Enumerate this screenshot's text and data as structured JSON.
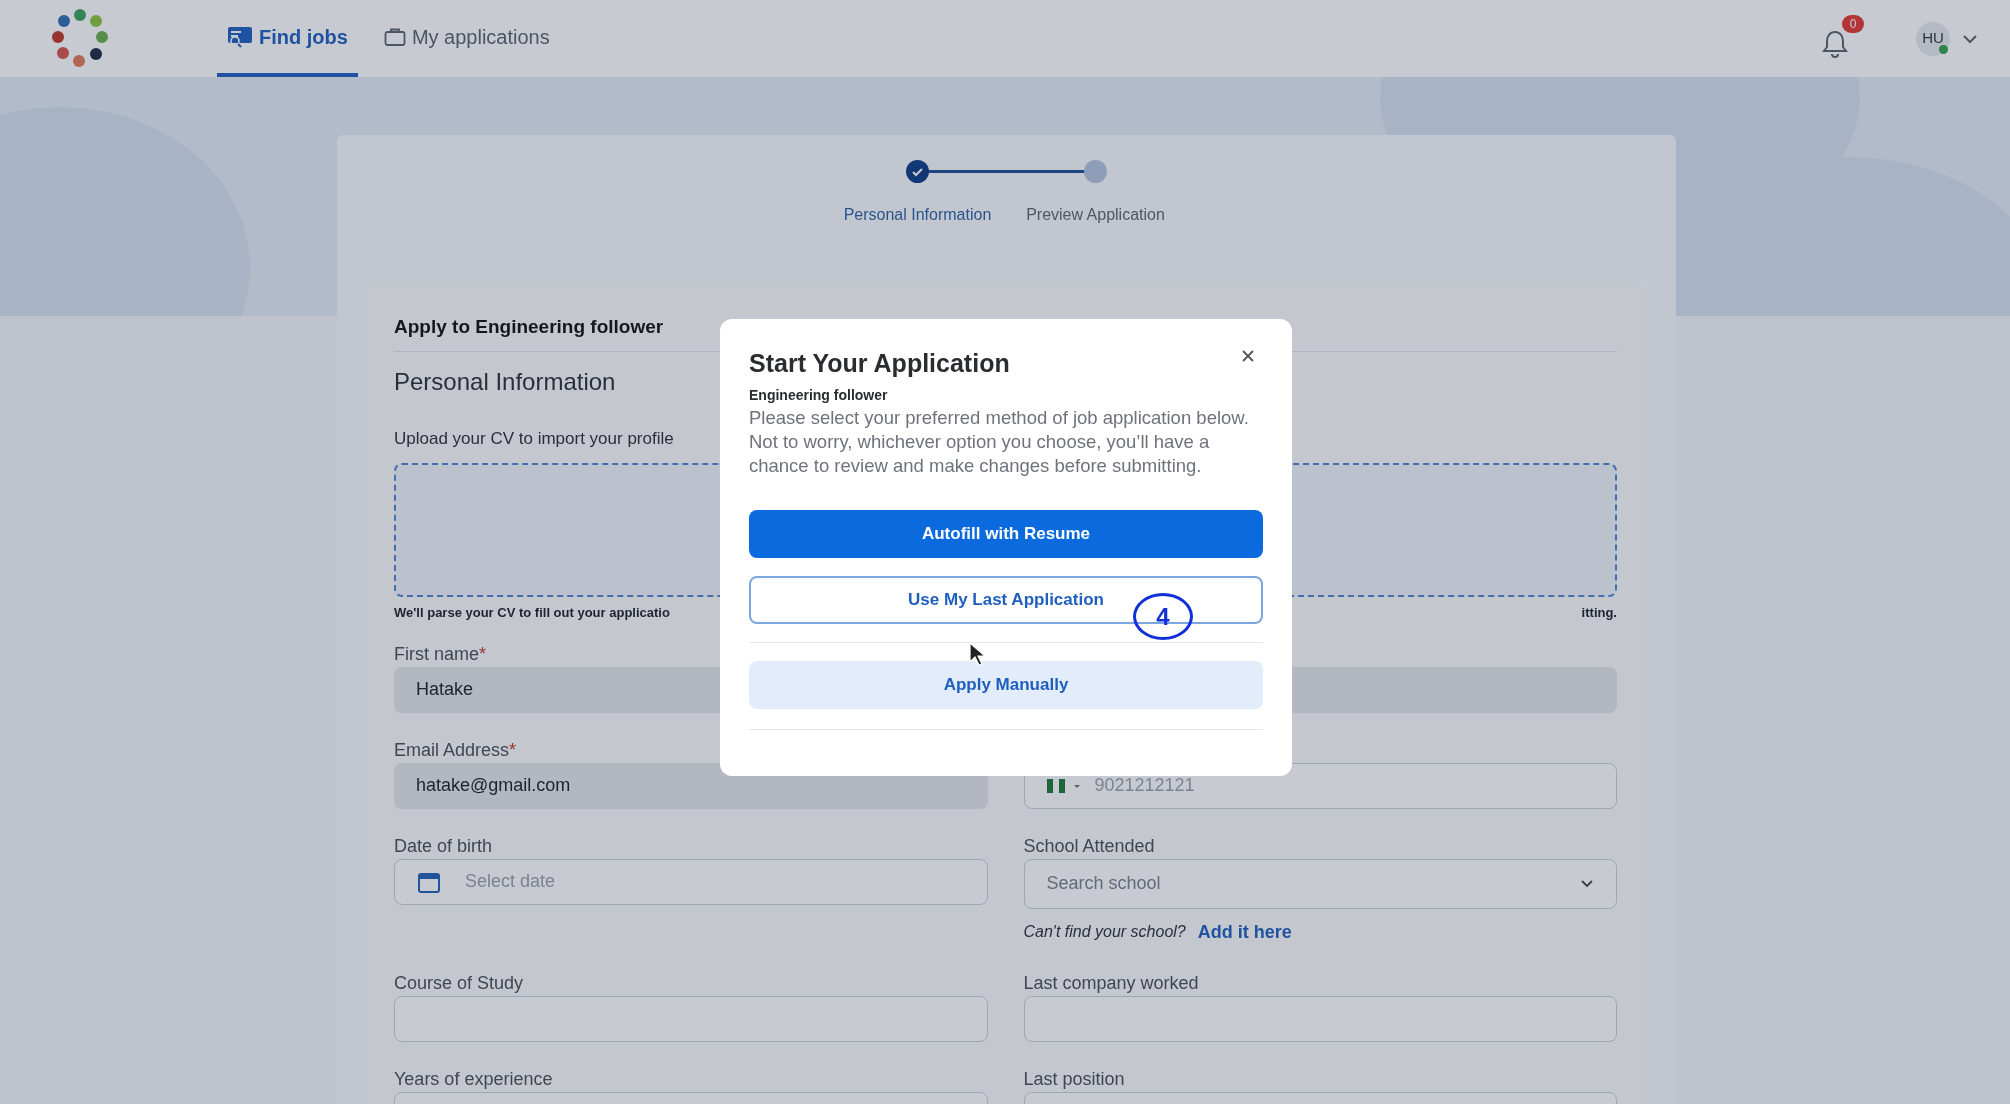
{
  "nav": {
    "tabs": [
      {
        "label": "Find jobs",
        "selected": true
      },
      {
        "label": "My applications",
        "selected": false
      }
    ],
    "notifications": {
      "count": "0"
    },
    "user": {
      "initials": "HU",
      "online": true
    }
  },
  "stepper": {
    "steps": [
      {
        "label": "Personal Information",
        "done": true,
        "selected": true
      },
      {
        "label": "Preview Application",
        "done": false,
        "selected": false
      }
    ]
  },
  "form": {
    "title": "Apply to Engineering follower",
    "section": "Personal Information",
    "upload_label": "Upload your CV to import your profile",
    "upload_hint_left": "We'll parse your CV to fill out your applicatio",
    "upload_hint_right": "itting.",
    "rows": [
      [
        {
          "kind": "text",
          "label": "First name",
          "required_mark": "*",
          "value": "Hatake",
          "readonly": true
        },
        {
          "kind": "text",
          "readonly": true
        }
      ],
      [
        {
          "kind": "text",
          "label": "Email Address",
          "required_mark": "*",
          "value": "hatake@gmail.com",
          "readonly": true
        },
        {
          "kind": "phone",
          "placeholder": "9021212121"
        }
      ],
      [
        {
          "kind": "date",
          "label": "Date of birth",
          "placeholder": "Select date"
        },
        {
          "kind": "select",
          "label": "School Attended",
          "placeholder": "Search school",
          "hint": "Can't find your school?",
          "hint_link": "Add it here"
        }
      ],
      [
        {
          "kind": "text",
          "label": "Course of Study"
        },
        {
          "kind": "text",
          "label": "Last company worked"
        }
      ],
      [
        {
          "kind": "text",
          "label": "Years of experience"
        },
        {
          "kind": "text",
          "label": "Last position"
        }
      ]
    ]
  },
  "modal": {
    "title": "Start Your Application",
    "subtitle": "Engineering follower",
    "text": "Please select your preferred method of job application below. Not to worry, whichever option you choose, you’ll have a chance to review and make changes before submitting.",
    "options": [
      {
        "label": "Autofill with Resume",
        "kind": "primary"
      },
      {
        "label": "Use My Last Application",
        "kind": "outline"
      },
      {
        "label": "Apply Manually",
        "kind": "soft"
      }
    ]
  },
  "annotation": {
    "label": "4"
  }
}
